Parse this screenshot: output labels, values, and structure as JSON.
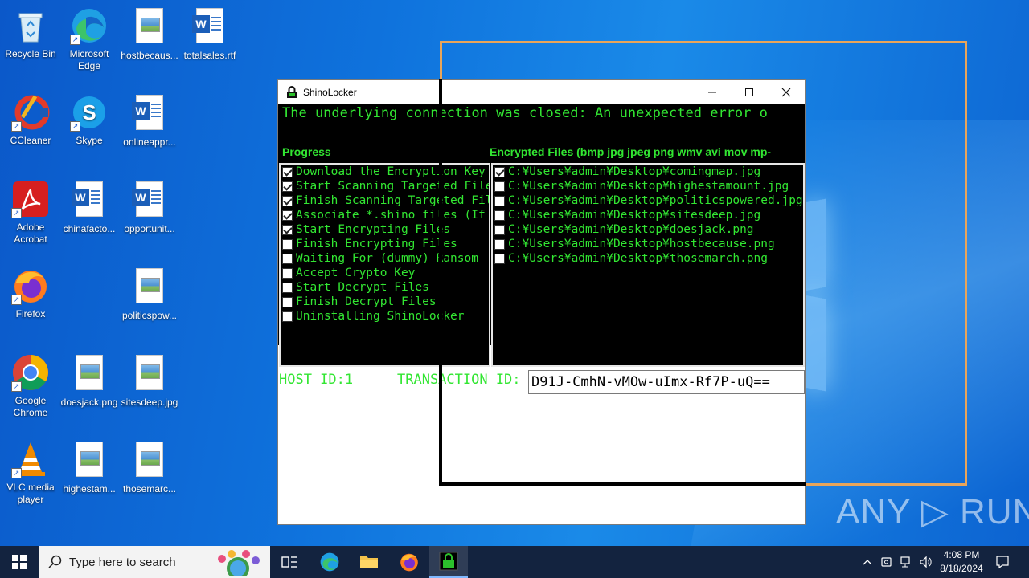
{
  "desktop": {
    "icons": [
      {
        "label": "Recycle Bin"
      },
      {
        "label": "Microsoft Edge"
      },
      {
        "label": "hostbecaus..."
      },
      {
        "label": "totalsales.rtf"
      },
      {
        "label": "CCleaner"
      },
      {
        "label": "Skype"
      },
      {
        "label": "onlineappr..."
      },
      {
        "label": "Adobe Acrobat"
      },
      {
        "label": "chinafacto..."
      },
      {
        "label": "opportunit..."
      },
      {
        "label": "Firefox"
      },
      {
        "label": "politicspow..."
      },
      {
        "label": "Google Chrome"
      },
      {
        "label": "doesjack.png"
      },
      {
        "label": "sitesdeep.jpg"
      },
      {
        "label": "VLC media player"
      },
      {
        "label": "highestam..."
      },
      {
        "label": "thosemarc..."
      }
    ]
  },
  "window": {
    "title": "ShinoLocker",
    "minimize": "—",
    "maximize": "☐",
    "close": "✕",
    "error_message": "The underlying connection was closed: An unexpected error o",
    "progress_heading": "Progress",
    "files_heading": "Encrypted Files (bmp jpg jpeg png wmv avi mov mp-",
    "progress_items": [
      {
        "label": "Download the Encryption Key",
        "checked": true
      },
      {
        "label": "Start  Scanning Targeted Files",
        "checked": true
      },
      {
        "label": "Finish Scanning Targeted Files",
        "checked": true
      },
      {
        "label": "Associate *.shino files (If ad",
        "checked": true
      },
      {
        "label": "Start  Encrypting Files",
        "checked": true
      },
      {
        "label": "Finish Encrypting Files",
        "checked": false
      },
      {
        "label": "Waiting For (dummy) Ransom",
        "checked": false
      },
      {
        "label": "Accept Crypto Key",
        "checked": false
      },
      {
        "label": "Start Decrypt Files",
        "checked": false
      },
      {
        "label": "Finish Decrypt Files",
        "checked": false
      },
      {
        "label": "Uninstalling ShinoLocker",
        "checked": false
      }
    ],
    "files": [
      {
        "label": "C:¥Users¥admin¥Desktop¥comingmap.jpg",
        "checked": true
      },
      {
        "label": "C:¥Users¥admin¥Desktop¥highestamount.jpg",
        "checked": false
      },
      {
        "label": "C:¥Users¥admin¥Desktop¥politicspowered.jpg",
        "checked": false
      },
      {
        "label": "C:¥Users¥admin¥Desktop¥sitesdeep.jpg",
        "checked": false
      },
      {
        "label": "C:¥Users¥admin¥Desktop¥doesjack.png",
        "checked": false
      },
      {
        "label": "C:¥Users¥admin¥Desktop¥hostbecause.png",
        "checked": false
      },
      {
        "label": "C:¥Users¥admin¥Desktop¥thosemarch.png",
        "checked": false
      }
    ],
    "host_id": "HOST ID:1",
    "transaction_label": "TRANSACTION ID:",
    "transaction_id": "D91J-CmhN-vMOw-uImx-Rf7P-uQ=="
  },
  "watermark": "ANY ▷ RUN",
  "taskbar": {
    "search_placeholder": "Type here to search",
    "time": "4:08 PM",
    "date": "8/18/2024"
  },
  "colors": {
    "console_green": "#32e632",
    "taskbar": "#13233f",
    "highlight_rect": "#e9a55a"
  }
}
